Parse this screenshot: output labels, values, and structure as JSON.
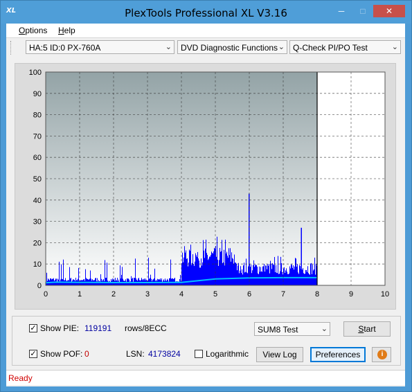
{
  "window": {
    "title": "PlexTools Professional XL V3.16",
    "icon_text": "XL"
  },
  "menu": {
    "items": [
      {
        "label_pre": "",
        "label_u": "O",
        "label_post": "ptions"
      },
      {
        "label_pre": "",
        "label_u": "H",
        "label_post": "elp"
      }
    ]
  },
  "toolbar": {
    "drive": "HA:5 ID:0  PX-760A",
    "function": "DVD Diagnostic Functions",
    "test": "Q-Check PI/PO Test"
  },
  "chart_data": {
    "type": "bar",
    "title": "",
    "xlabel": "",
    "ylabel": "",
    "xlim": [
      0,
      10
    ],
    "ylim": [
      0,
      100
    ],
    "x_ticks": [
      "0",
      "1",
      "2",
      "3",
      "4",
      "5",
      "6",
      "7",
      "8",
      "9",
      "10"
    ],
    "y_ticks": [
      "0",
      "10",
      "20",
      "30",
      "40",
      "50",
      "60",
      "70",
      "80",
      "90",
      "100"
    ],
    "grid": true,
    "data_end_x": 8,
    "series": [
      {
        "type": "bar",
        "color": "#0000ff",
        "segments": [
          {
            "x_from": 0,
            "x_to": 4,
            "typical": 3,
            "max": 13
          },
          {
            "x_from": 4,
            "x_to": 5.6,
            "typical": 15,
            "max": 23
          },
          {
            "x_from": 5.6,
            "x_to": 8,
            "typical": 9,
            "max": 14
          }
        ],
        "spikes": [
          {
            "x": 5.98,
            "y": 43
          },
          {
            "x": 7.52,
            "y": 27
          }
        ]
      },
      {
        "type": "line",
        "color": "#00c0ff",
        "x": [
          0,
          0.3,
          1,
          2,
          3,
          4,
          4.5,
          5,
          6,
          7,
          8
        ],
        "y": [
          1.2,
          1.5,
          1.4,
          1.3,
          1.3,
          1.4,
          2.2,
          3.0,
          3.5,
          3.6,
          3.6
        ]
      }
    ]
  },
  "controls": {
    "show_pie_label": "Show PIE:",
    "pie_value": "119191",
    "rows_label": "rows/8ECC",
    "show_poe_label": "Show POF:",
    "poe_value": "0",
    "lsn_label": "LSN:",
    "lsn_value": "4173824",
    "log_label": "Logarithmic",
    "sum_select": "SUM8 Test",
    "start_label_u": "S",
    "start_label_post": "tart",
    "viewlog_label": "View Log",
    "preferences_label": "Preferences",
    "info": "i"
  },
  "status": {
    "text": "Ready"
  }
}
